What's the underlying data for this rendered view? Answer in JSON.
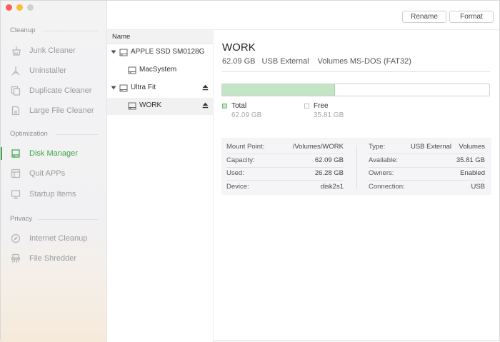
{
  "sidebar": {
    "sections": [
      {
        "label": "Cleanup"
      },
      {
        "label": "Optimization"
      },
      {
        "label": "Privacy"
      }
    ],
    "items": [
      {
        "label": "Junk Cleaner",
        "icon": "broom-icon"
      },
      {
        "label": "Uninstaller",
        "icon": "uninstall-icon"
      },
      {
        "label": "Duplicate Cleaner",
        "icon": "duplicate-icon"
      },
      {
        "label": "Large File Cleaner",
        "icon": "large-file-icon"
      },
      {
        "label": "Disk Manager",
        "icon": "disk-icon",
        "active": true
      },
      {
        "label": "Quit APPs",
        "icon": "quit-apps-icon"
      },
      {
        "label": "Startup Items",
        "icon": "startup-icon"
      },
      {
        "label": "Internet Cleanup",
        "icon": "compass-icon"
      },
      {
        "label": "File Shredder",
        "icon": "shredder-icon"
      }
    ]
  },
  "toolbar": {
    "rename_label": "Rename",
    "format_label": "Format"
  },
  "devices": {
    "header": "Name",
    "rows": [
      {
        "label": "APPLE SSD SM0128G",
        "expanded": true
      },
      {
        "label": "MacSystem"
      },
      {
        "label": "Ultra Fit",
        "expanded": true
      },
      {
        "label": "WORK",
        "selected": true
      }
    ]
  },
  "detail": {
    "title": "WORK",
    "size": "62.09 GB",
    "bus": "USB External",
    "format": "Volumes MS-DOS (FAT32)",
    "used_fraction": 0.423,
    "legend": {
      "total_label": "Total",
      "total_value": "62.09 GB",
      "free_label": "Free",
      "free_value": "35.81 GB"
    },
    "info_left": [
      {
        "key": "Mount Point:",
        "value": "/Volumes/WORK"
      },
      {
        "key": "Capacity:",
        "value": "62.09 GB"
      },
      {
        "key": "Used:",
        "value": "26.28 GB"
      },
      {
        "key": "Device:",
        "value": "disk2s1"
      }
    ],
    "info_right": [
      {
        "key": "Type:",
        "value": "USB External    Volumes"
      },
      {
        "key": "Available:",
        "value": "35.81 GB"
      },
      {
        "key": "Owners:",
        "value": "Enabled"
      },
      {
        "key": "Connection:",
        "value": "USB"
      }
    ]
  },
  "colors": {
    "accent": "#3fa34d",
    "used_fill": "#c4e4c6"
  }
}
